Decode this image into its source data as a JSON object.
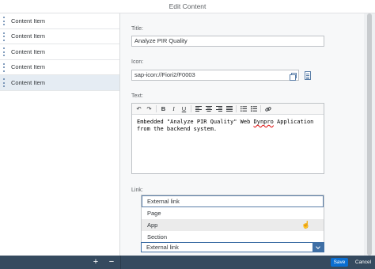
{
  "window": {
    "title": "Edit Content"
  },
  "sidebar": {
    "items": [
      {
        "label": "Content Item"
      },
      {
        "label": "Content Item"
      },
      {
        "label": "Content Item"
      },
      {
        "label": "Content Item"
      },
      {
        "label": "Content Item"
      }
    ],
    "selected_index": 4
  },
  "form": {
    "title_label": "Title:",
    "title_value": "Analyze PIR Quality",
    "icon_label": "Icon:",
    "icon_value": "sap-icon://Fiori2/F0003",
    "text_label": "Text:",
    "text_value_before": "Embedded \"Analyze PIR Quality\" Web ",
    "text_value_misspelled": "Dynpro",
    "text_value_after": " Application from the backend system.",
    "link_label": "Link:"
  },
  "toolbar": {
    "undo": "↶",
    "redo": "↷",
    "bold": "B",
    "italic": "I",
    "underline": "U",
    "bullet_list": "☰",
    "numbered_list": "☷",
    "link": "🔗"
  },
  "link_dropdown": {
    "options": [
      "External link",
      "Page",
      "App",
      "Section"
    ],
    "focused_index": 0,
    "hovered_index": 2,
    "selected_value": "External link"
  },
  "footer": {
    "add": "+",
    "remove": "−",
    "save_label": "Save",
    "cancel_label": "Cancel"
  },
  "colors": {
    "accent": "#0a6ed1",
    "shell": "#354a5f",
    "selection": "#e5ecf3"
  }
}
